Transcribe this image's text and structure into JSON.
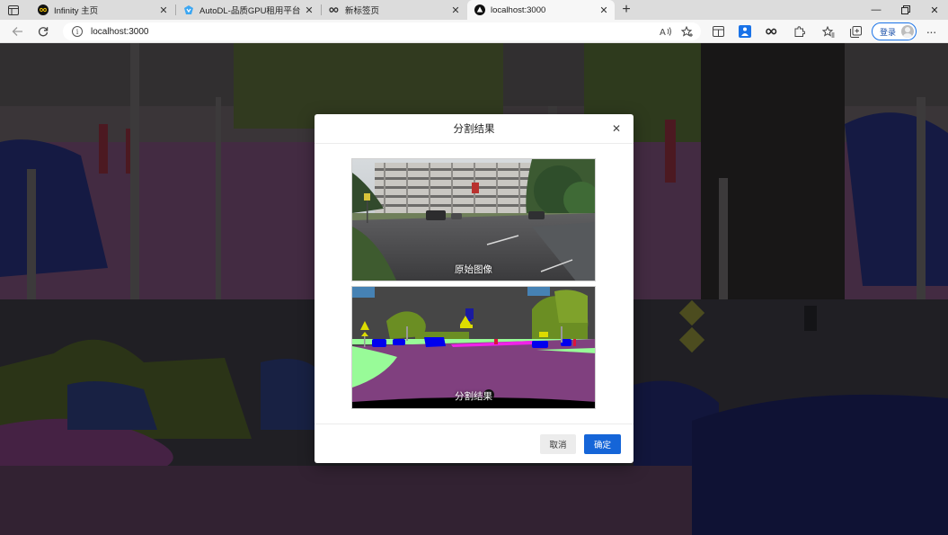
{
  "browser": {
    "tabs": [
      {
        "title": "Infinity 主页",
        "icon": "infinity-icon"
      },
      {
        "title": "AutoDL-品质GPU租用平台-租GPU",
        "icon": "autodl-logo-icon"
      },
      {
        "title": "新标签页",
        "icon": "infinity-icon"
      },
      {
        "title": "localhost:3000",
        "icon": "app-logo-icon",
        "active": true
      }
    ],
    "address_url": "localhost:3000",
    "login_label": "登录"
  },
  "modal": {
    "title": "分割结果",
    "original_caption": "原始图像",
    "result_caption": "分割结果",
    "cancel_label": "取消",
    "ok_label": "确定"
  },
  "colors": {
    "primary": "#1565d8",
    "road": "#80407f",
    "vegetation": "#6b8e23",
    "car": "#0000ee",
    "sky": "#4682b4",
    "building": "#464646",
    "sidewalk": "#f023e8",
    "terrain": "#98fb98",
    "traffic_sign": "#dcdc00"
  }
}
